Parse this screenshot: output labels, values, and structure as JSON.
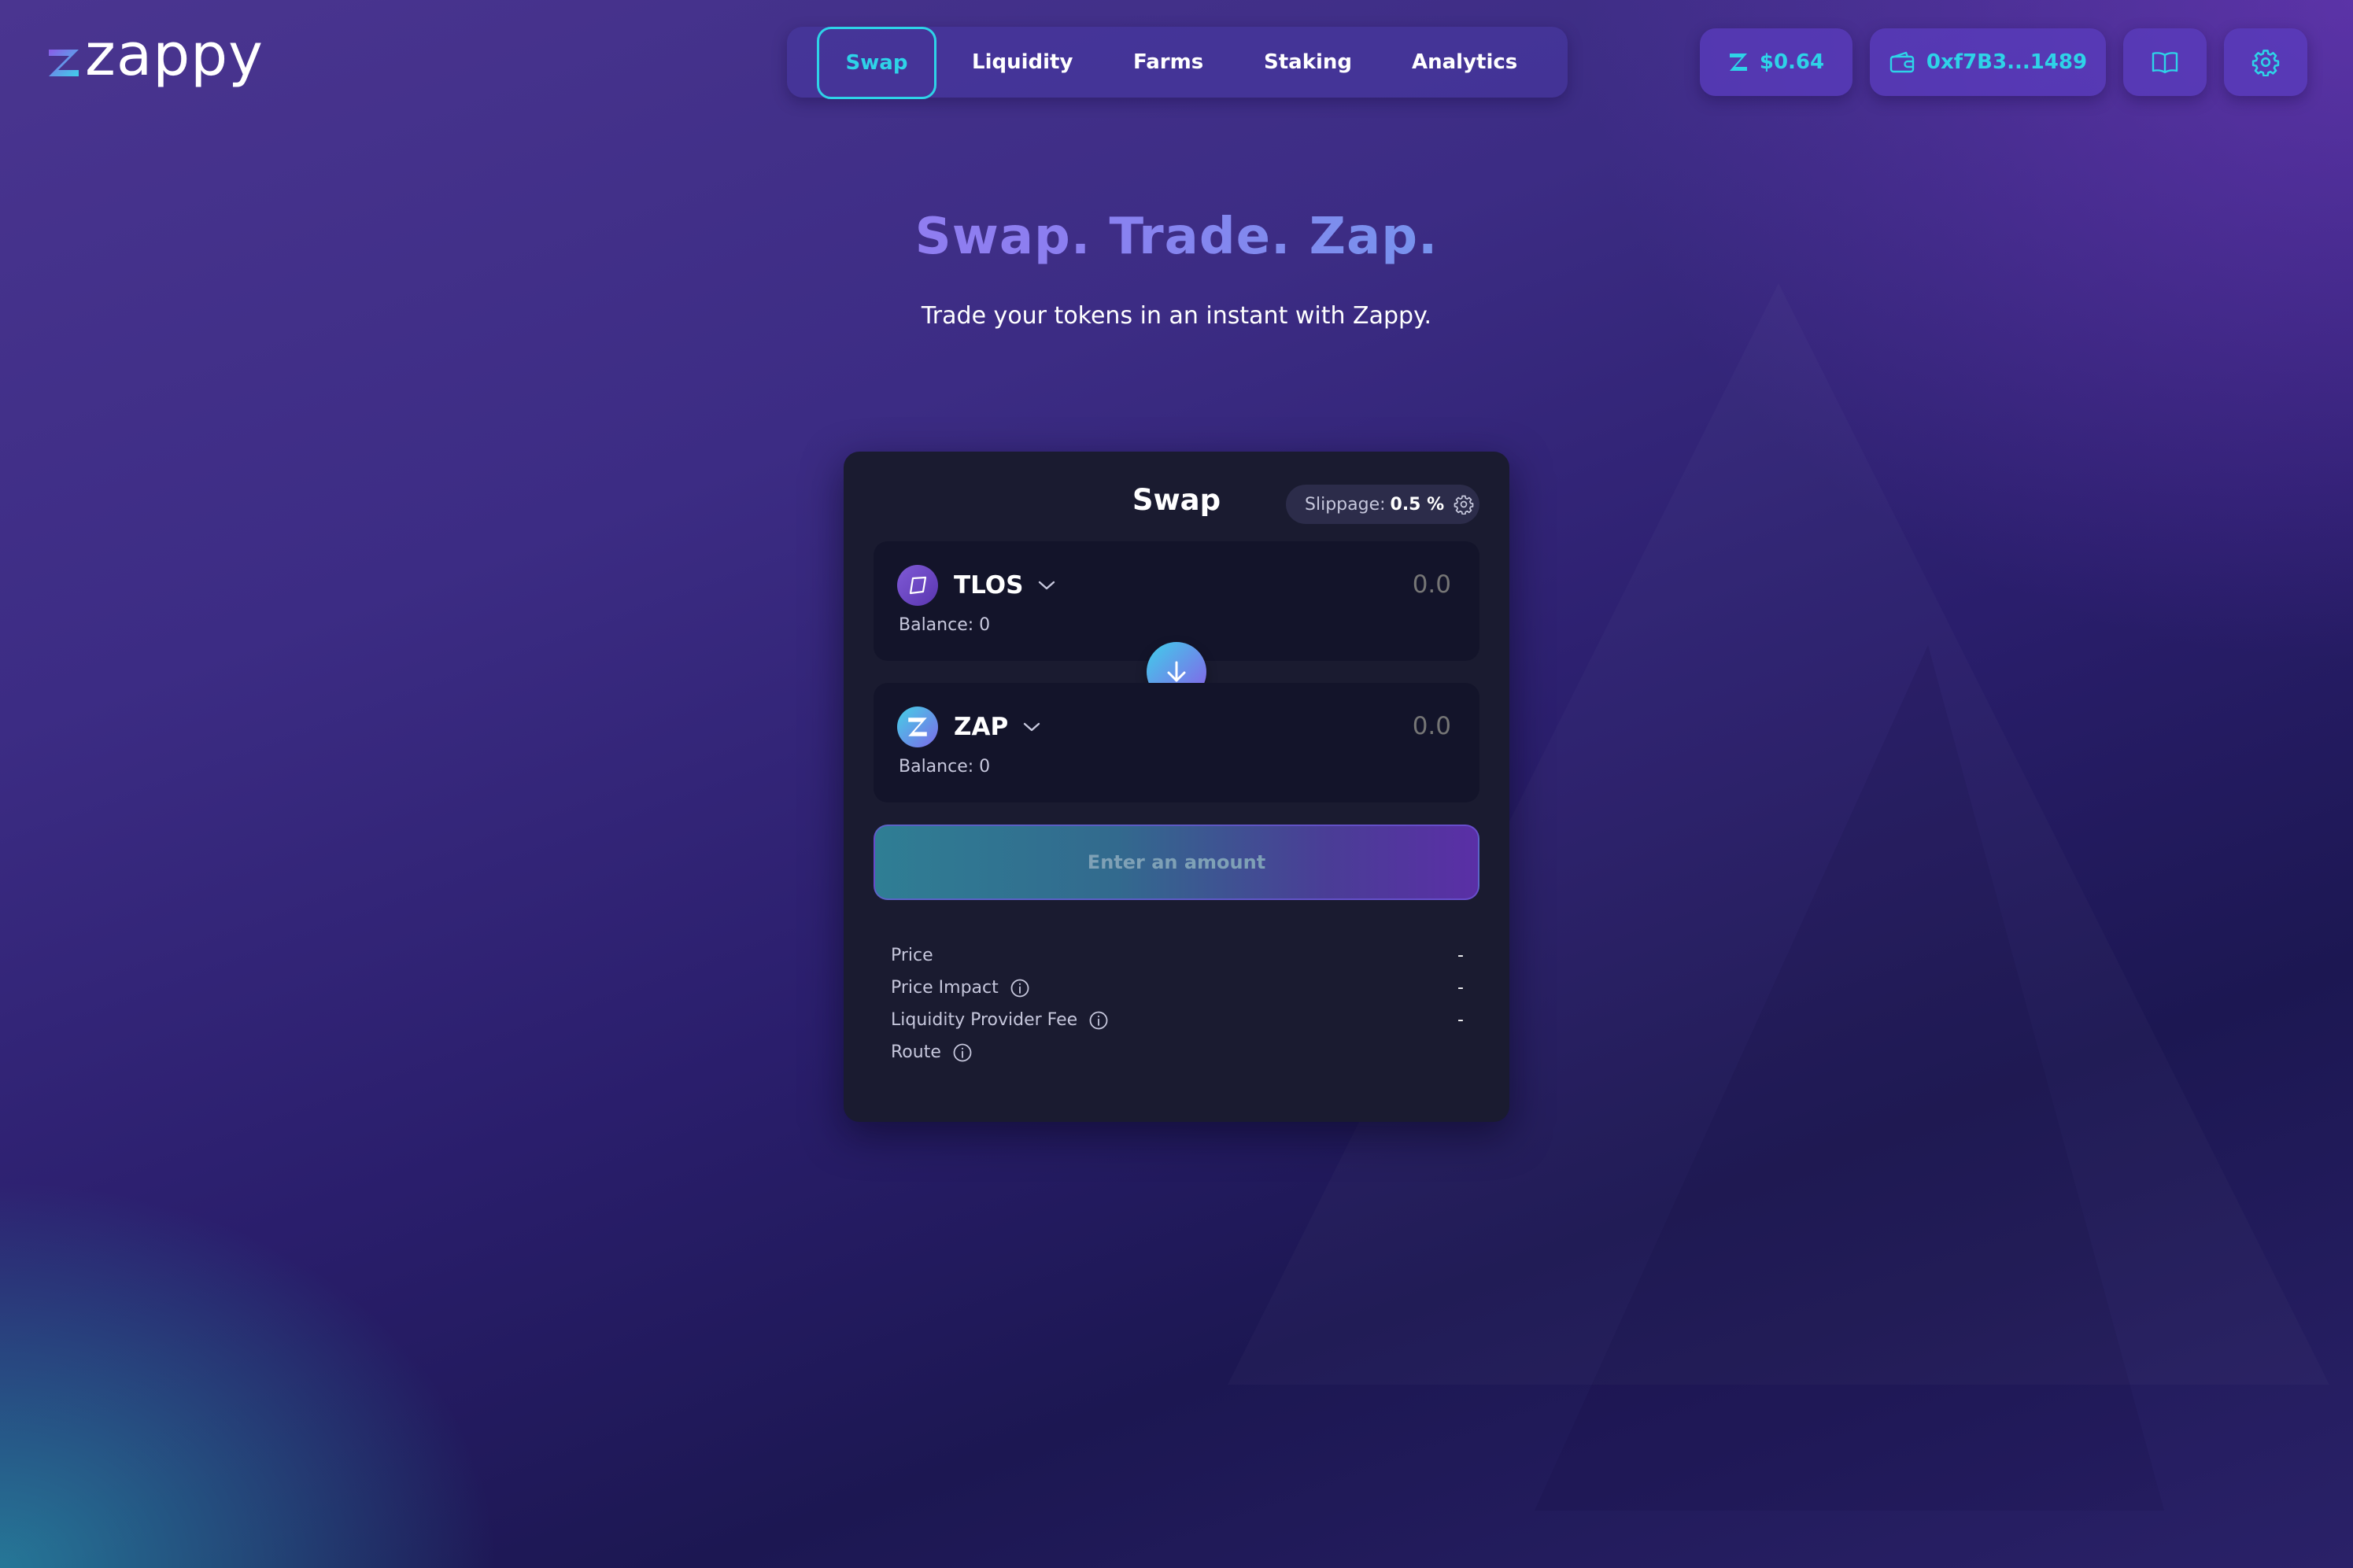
{
  "brand": {
    "name": "zappy"
  },
  "nav": {
    "tabs": [
      {
        "label": "Swap",
        "active": true
      },
      {
        "label": "Liquidity"
      },
      {
        "label": "Farms"
      },
      {
        "label": "Staking"
      },
      {
        "label": "Analytics"
      }
    ]
  },
  "header": {
    "token_price": "$0.64",
    "wallet_address": "0xf7B3...1489",
    "icons": [
      "zap-token-icon",
      "wallet-icon",
      "docs-book-icon",
      "settings-gear-icon"
    ]
  },
  "hero": {
    "title": "Swap. Trade. Zap.",
    "subtitle": "Trade your tokens in an instant with Zappy."
  },
  "swap": {
    "title": "Swap",
    "slippage_label": "Slippage:",
    "slippage_value": "0.5 %",
    "from": {
      "symbol": "TLOS",
      "balance": "Balance: 0",
      "amount_placeholder": "0.0"
    },
    "to": {
      "symbol": "ZAP",
      "balance": "Balance: 0",
      "amount_placeholder": "0.0"
    },
    "cta_label": "Enter an amount",
    "details": [
      {
        "label": "Price",
        "value": "-"
      },
      {
        "label": "Price Impact",
        "value": "-"
      },
      {
        "label": "Liquidity Provider Fee",
        "value": "-"
      },
      {
        "label": "Route",
        "value": ""
      }
    ]
  },
  "colors": {
    "accent": "#2ed3e8",
    "card_bg": "#1a1b30",
    "token_box_bg": "#13142a",
    "title_gradient_start": "#a777ee",
    "title_gradient_end": "#45c6e6"
  }
}
